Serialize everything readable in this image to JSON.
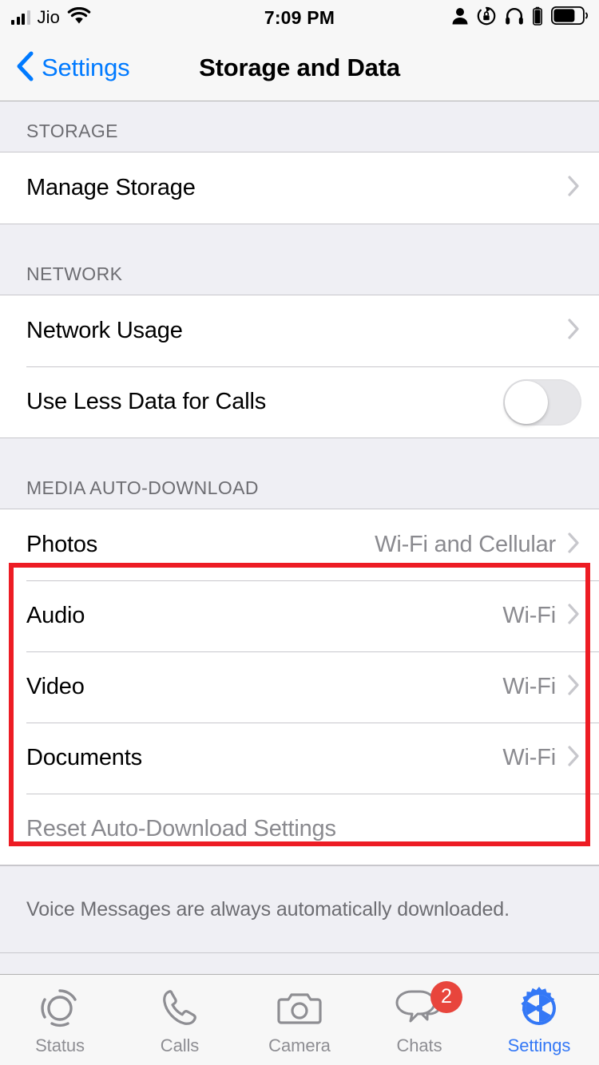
{
  "status_bar": {
    "carrier": "Jio",
    "signal_bars_filled": 3,
    "signal_bars_total": 4,
    "wifi_icon": "wifi-icon",
    "time": "7:09 PM",
    "right_icons": [
      "person-icon",
      "rotation-lock-icon",
      "headphones-icon",
      "headphone-battery-icon",
      "battery-icon"
    ]
  },
  "nav_bar": {
    "back_label": "Settings",
    "back_icon": "chevron-left-icon",
    "title": "Storage and Data"
  },
  "sections": [
    {
      "header": "STORAGE",
      "rows": [
        {
          "label": "Manage Storage",
          "value": "",
          "accessory": "chevron-right-icon"
        }
      ]
    },
    {
      "header": "NETWORK",
      "rows": [
        {
          "label": "Network Usage",
          "value": "",
          "accessory": "chevron-right-icon"
        },
        {
          "label": "Use Less Data for Calls",
          "value": "",
          "accessory": "toggle",
          "toggle_on": false
        }
      ]
    },
    {
      "header": "MEDIA AUTO-DOWNLOAD",
      "rows": [
        {
          "label": "Photos",
          "value": "Wi-Fi and Cellular",
          "accessory": "chevron-right-icon"
        },
        {
          "label": "Audio",
          "value": "Wi-Fi",
          "accessory": "chevron-right-icon"
        },
        {
          "label": "Video",
          "value": "Wi-Fi",
          "accessory": "chevron-right-icon"
        },
        {
          "label": "Documents",
          "value": "Wi-Fi",
          "accessory": "chevron-right-icon"
        },
        {
          "label": "Reset Auto-Download Settings",
          "value": "",
          "accessory": "none",
          "muted": true
        }
      ],
      "footer": "Voice Messages are always automatically downloaded."
    }
  ],
  "highlight": {
    "color": "#ED1C24",
    "covers": [
      "Photos",
      "Audio",
      "Video",
      "Documents"
    ]
  },
  "tab_bar": {
    "items": [
      {
        "label": "Status",
        "icon": "status-rings-icon",
        "active": false,
        "badge": ""
      },
      {
        "label": "Calls",
        "icon": "phone-icon",
        "active": false,
        "badge": ""
      },
      {
        "label": "Camera",
        "icon": "camera-icon",
        "active": false,
        "badge": ""
      },
      {
        "label": "Chats",
        "icon": "chat-bubbles-icon",
        "active": false,
        "badge": "2"
      },
      {
        "label": "Settings",
        "icon": "gear-icon",
        "active": true,
        "badge": ""
      }
    ]
  },
  "colors": {
    "accent_blue": "#007AFF",
    "tab_active_blue": "#3478F6",
    "group_bg": "#EFEFF4",
    "cell_bg": "#FFFFFF",
    "secondary_text": "#8A8A8F",
    "header_text": "#6D6D72",
    "badge_red": "#E8453C",
    "highlight_red": "#ED1C24"
  }
}
